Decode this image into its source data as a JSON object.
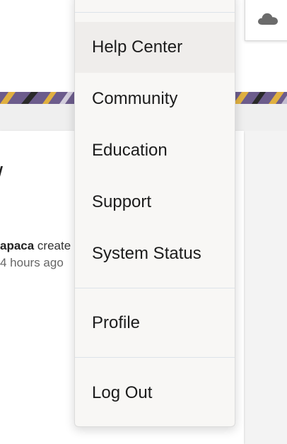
{
  "menu": {
    "items": [
      {
        "key": "help-center",
        "label": "Help Center"
      },
      {
        "key": "community",
        "label": "Community"
      },
      {
        "key": "education",
        "label": "Education"
      },
      {
        "key": "support",
        "label": "Support"
      },
      {
        "key": "system-status",
        "label": "System Status"
      }
    ],
    "profile_label": "Profile",
    "logout_label": "Log Out"
  },
  "card": {
    "title_fragment": "/",
    "author_fragment": "apaca",
    "action_fragment": " create",
    "time_fragment": "4 hours ago"
  },
  "icons": {
    "cloud": "cloud-icon"
  },
  "colors": {
    "menu_background": "#f8f7f5",
    "hover_background": "#efedeb",
    "divider": "#dde3ea",
    "banner_purple": "#6c5c8c",
    "banner_yellow": "#e0b040"
  }
}
